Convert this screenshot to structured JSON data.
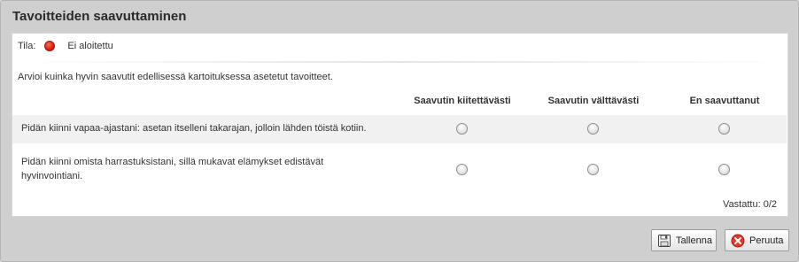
{
  "dialog": {
    "title": "Tavoitteiden saavuttaminen"
  },
  "status": {
    "label": "Tila:",
    "value": "Ei aloitettu",
    "indicator_color": "#d3150a"
  },
  "instruction": "Arvioi kuinka hyvin saavutit edellisessä kartoituksessa asetetut tavoitteet.",
  "columns": [
    "Saavutin kiitettävästi",
    "Saavutin välttävästi",
    "En saavuttanut"
  ],
  "goals": [
    {
      "text_lines": [
        "Pidän kiinni vapaa-ajastani: asetan itselleni takarajan, jolloin lähden töistä kotiin."
      ]
    },
    {
      "text_lines": [
        "Pidän kiinni omista harrastuksistani, sillä mukavat elämykset edistävät",
        "hyvinvointiani."
      ]
    }
  ],
  "answered": "Vastattu: 0/2",
  "buttons": {
    "save_label": "Tallenna",
    "cancel_label": "Peruuta",
    "save_icon": "floppy-disk-icon",
    "cancel_icon": "cancel-x-icon"
  }
}
